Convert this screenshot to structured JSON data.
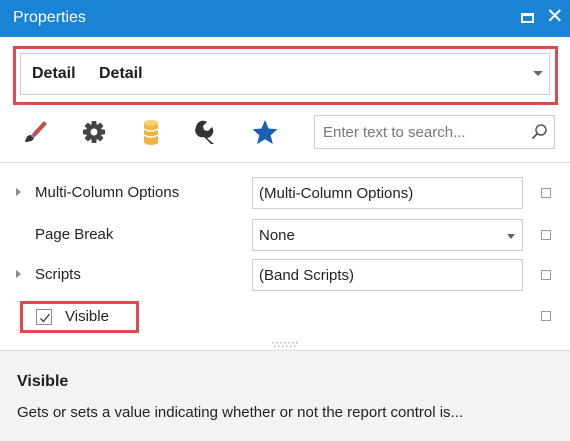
{
  "window": {
    "title": "Properties"
  },
  "selector": {
    "name": "Detail",
    "type": "Detail"
  },
  "toolbar": {
    "tabs": [
      {
        "icon": "brush-icon",
        "color": "#c0504d"
      },
      {
        "icon": "gear-icon",
        "color": "#444444"
      },
      {
        "icon": "database-icon",
        "color": "#f0b43c"
      },
      {
        "icon": "wrench-icon",
        "color": "#333333"
      },
      {
        "icon": "star-icon",
        "color": "#1a5fb4"
      }
    ],
    "search_placeholder": "Enter text to search..."
  },
  "properties": [
    {
      "name": "Multi-Column Options",
      "value": "(Multi-Column Options)",
      "expandable": true,
      "dropdown": false
    },
    {
      "name": "Page Break",
      "value": "None",
      "expandable": false,
      "dropdown": true
    },
    {
      "name": "Scripts",
      "value": "(Band Scripts)",
      "expandable": true,
      "dropdown": false
    }
  ],
  "visible_property": {
    "label": "Visible",
    "checked": true
  },
  "description": {
    "title": "Visible",
    "text": "Gets or sets a value indicating whether or not the report control is..."
  },
  "colors": {
    "titlebar": "#1a84d4",
    "highlight": "#e2474b"
  }
}
